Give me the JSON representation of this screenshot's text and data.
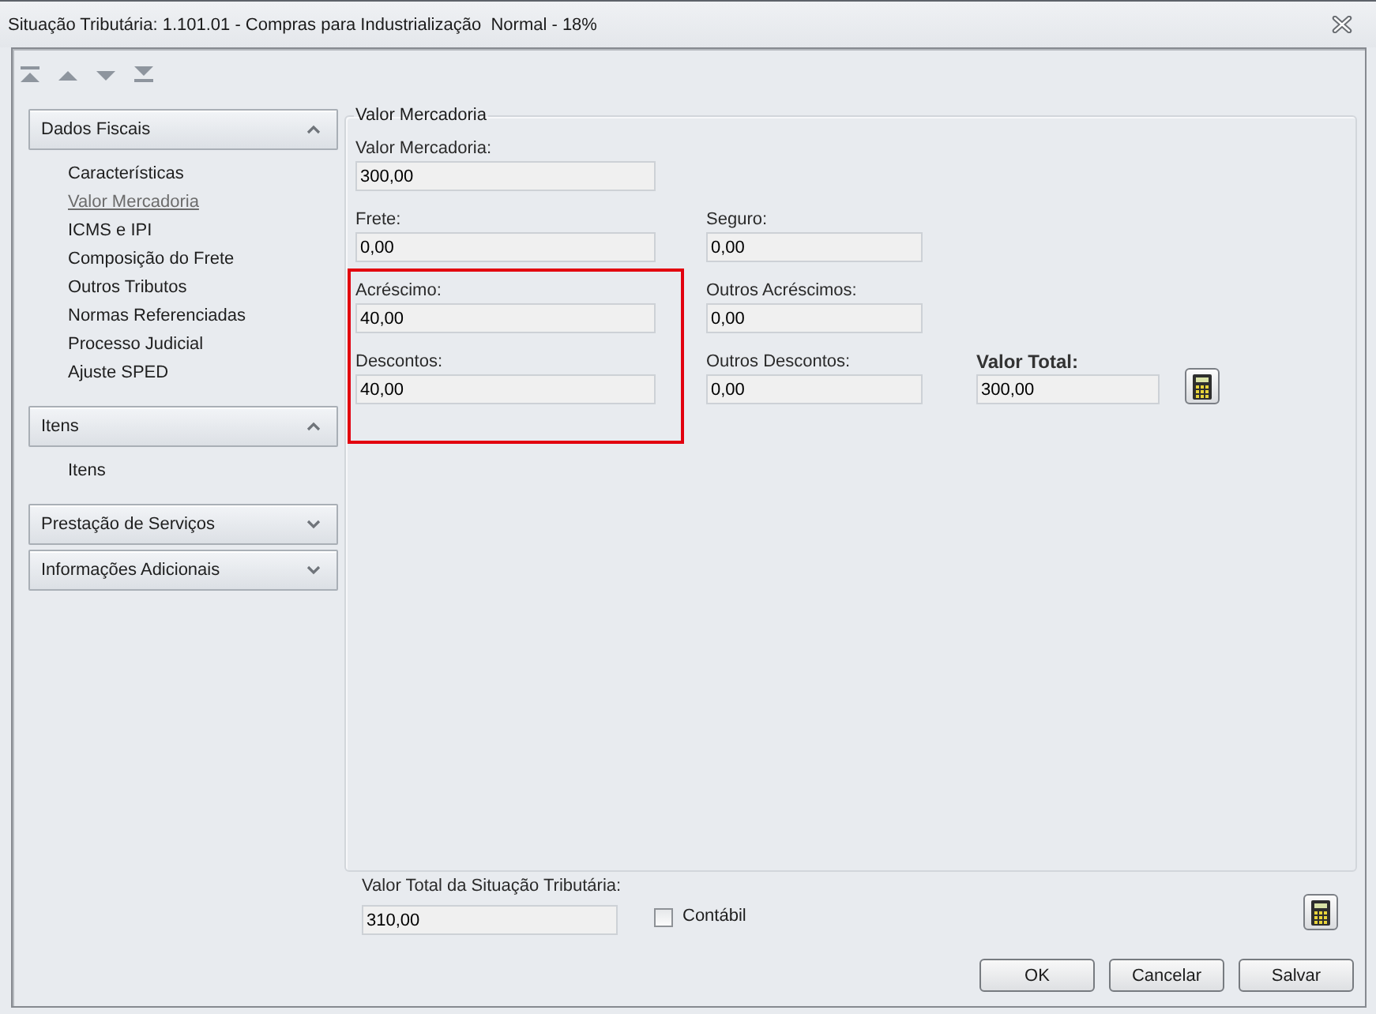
{
  "window": {
    "title": "Situação Tributária: 1.101.01 - Compras para Industrialização  Normal - 18%"
  },
  "sidebar": {
    "sections": [
      {
        "title": "Dados Fiscais",
        "expanded": true,
        "items": [
          {
            "label": "Características",
            "selected": false
          },
          {
            "label": "Valor Mercadoria",
            "selected": true
          },
          {
            "label": "ICMS e IPI",
            "selected": false
          },
          {
            "label": "Composição do Frete",
            "selected": false
          },
          {
            "label": "Outros Tributos",
            "selected": false
          },
          {
            "label": "Normas Referenciadas",
            "selected": false
          },
          {
            "label": "Processo Judicial",
            "selected": false
          },
          {
            "label": "Ajuste SPED",
            "selected": false
          }
        ]
      },
      {
        "title": "Itens",
        "expanded": true,
        "items": [
          {
            "label": "Itens",
            "selected": false
          }
        ]
      },
      {
        "title": "Prestação de Serviços",
        "expanded": false
      },
      {
        "title": "Informações Adicionais",
        "expanded": false
      }
    ]
  },
  "panel": {
    "title": "Valor Mercadoria",
    "rows": [
      {
        "fields": [
          {
            "kind": "plain",
            "label": "Valor Mercadoria:",
            "value": "300,00",
            "highlighted": false
          }
        ]
      },
      {
        "fields": [
          {
            "kind": "plain",
            "label": "Frete:",
            "value": "0,00",
            "highlighted": false
          },
          {
            "kind": "plain",
            "label": "Seguro:",
            "value": "0,00",
            "highlighted": false
          }
        ]
      },
      {
        "fields": [
          {
            "kind": "plain",
            "label": "Acréscimo:",
            "value": "40,00",
            "highlighted": true
          },
          {
            "kind": "plain",
            "label": "Outros Acréscimos:",
            "value": "0,00",
            "highlighted": false
          }
        ]
      },
      {
        "fields": [
          {
            "kind": "plain",
            "label": "Descontos:",
            "value": "40,00",
            "highlighted": true
          },
          {
            "kind": "plain",
            "label": "Outros Descontos:",
            "value": "0,00",
            "highlighted": false
          },
          {
            "kind": "total",
            "label": "Valor Total:",
            "value": "300,00",
            "highlighted": false
          }
        ]
      }
    ]
  },
  "footer": {
    "total": {
      "label": "Valor Total da Situação Tributária:",
      "value": "310,00"
    },
    "contabil": {
      "label": "Contábil",
      "checked": false
    },
    "buttons": [
      {
        "label": "OK"
      },
      {
        "label": "Cancelar"
      },
      {
        "label": "Salvar"
      }
    ]
  }
}
